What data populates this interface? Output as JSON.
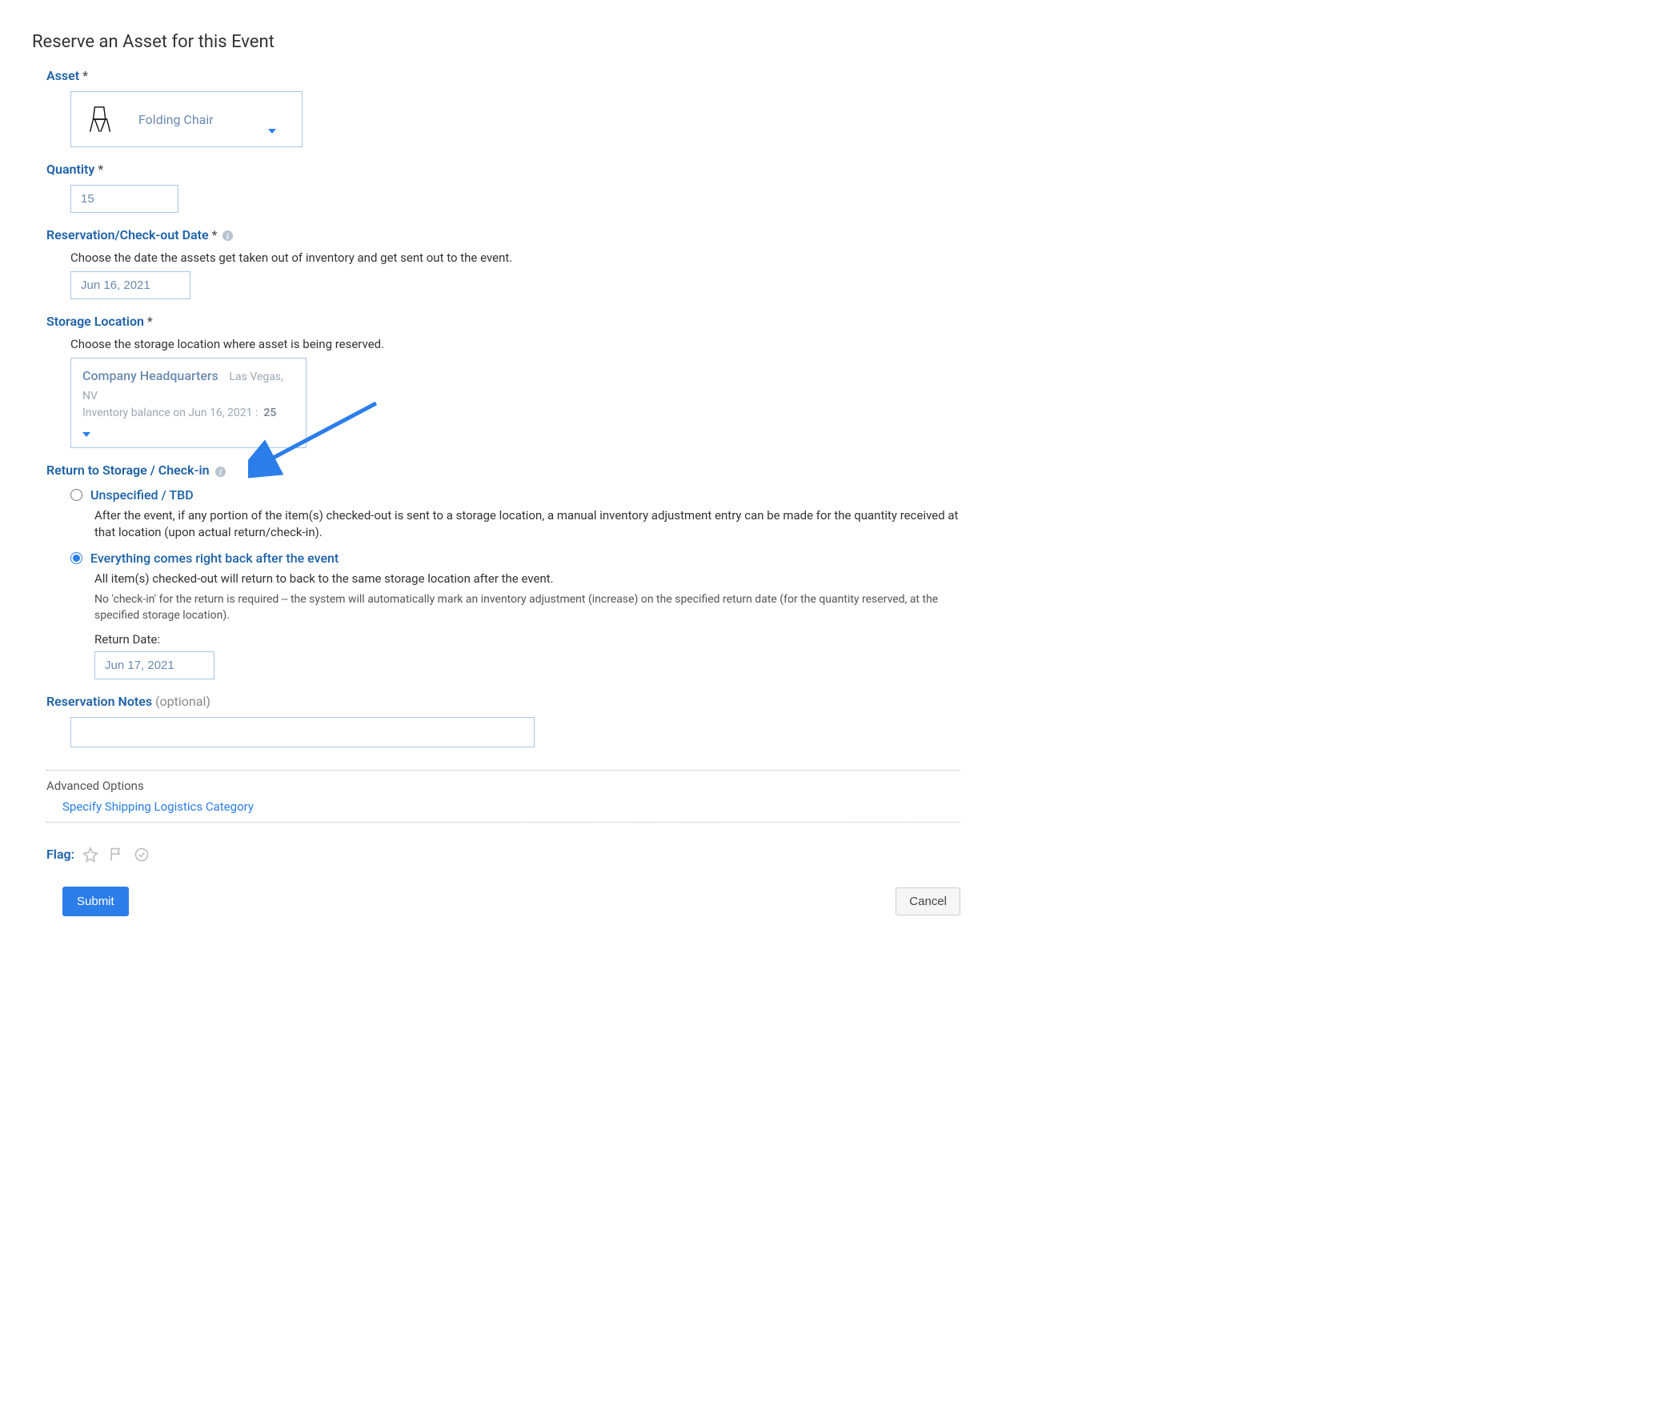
{
  "title": "Reserve an Asset for this Event",
  "asset": {
    "label": "Asset",
    "required": "*",
    "selected_name": "Folding Chair"
  },
  "quantity": {
    "label": "Quantity",
    "required": "*",
    "value": "15"
  },
  "checkout": {
    "label": "Reservation/Check-out Date",
    "required": "*",
    "helper": "Choose the date the assets get taken out of inventory and get sent out to the event.",
    "value": "Jun 16, 2021"
  },
  "storage": {
    "label": "Storage Location",
    "required": "*",
    "helper": "Choose the storage location where asset is being reserved.",
    "name": "Company Headquarters",
    "location": "Las Vegas, NV",
    "balance_prefix": "Inventory balance on Jun 16, 2021 :",
    "balance_value": "25"
  },
  "return": {
    "label": "Return to Storage / Check-in",
    "option_unspecified": {
      "label": "Unspecified / TBD",
      "desc": "After the event, if any portion of the item(s) checked-out is sent to a storage location, a manual inventory adjustment entry can be made for the quantity received at that location (upon actual return/check-in)."
    },
    "option_everything": {
      "label": "Everything comes right back after the event",
      "desc1": "All item(s) checked-out will return to back to the same storage location after the event.",
      "desc2": "No 'check-in' for the return is required -- the system will automatically mark an inventory adjustment (increase) on the specified return date (for the quantity reserved, at the specified storage location).",
      "return_date_label": "Return Date:",
      "return_date_value": "Jun 17, 2021"
    }
  },
  "notes": {
    "label": "Reservation Notes",
    "optional": "(optional)",
    "value": ""
  },
  "advanced": {
    "title": "Advanced Options",
    "link": "Specify Shipping Logistics Category"
  },
  "flag": {
    "label": "Flag:"
  },
  "buttons": {
    "submit": "Submit",
    "cancel": "Cancel"
  }
}
